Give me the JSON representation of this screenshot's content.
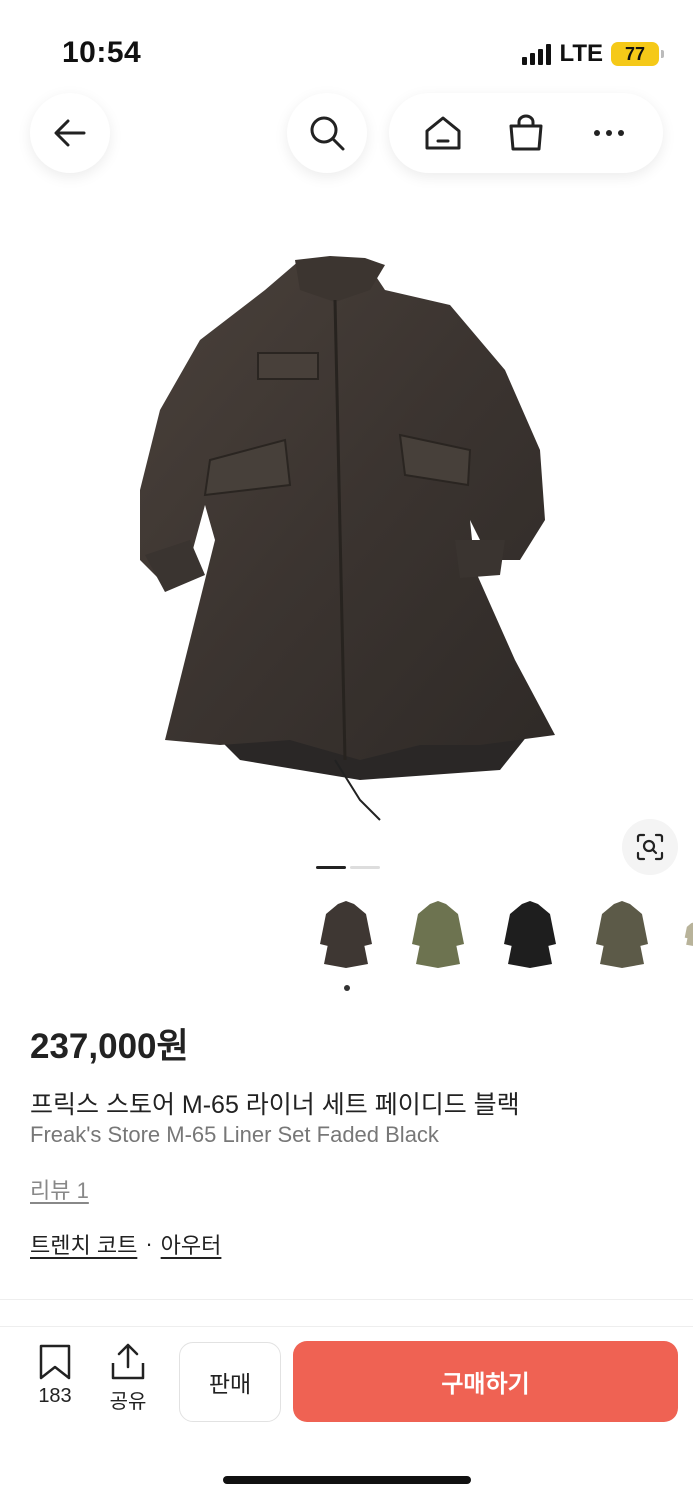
{
  "status": {
    "time": "10:54",
    "network": "LTE",
    "battery": "77"
  },
  "nav": {
    "back_icon": "arrow-left-icon",
    "search_icon": "search-icon",
    "home_icon": "home-icon",
    "cart_icon": "shopping-bag-icon",
    "more_icon": "more-horizontal-icon"
  },
  "gallery": {
    "page_index": 1,
    "page_count": 2,
    "thumbnails": [
      {
        "color": "#3e3733"
      },
      {
        "color": "#6d7350"
      },
      {
        "color": "#1e1e1e"
      },
      {
        "color": "#5c5a48"
      },
      {
        "color": "#b8b39a"
      }
    ],
    "selected_thumbnail": 0
  },
  "product": {
    "price": "237,000원",
    "title_ko": "프릭스 스토어 M-65 라이너 세트 페이디드 블랙",
    "title_en": "Freak's Store M-65 Liner Set Faded Black",
    "reviews": "리뷰 1",
    "category_1": "트렌치 코트",
    "separator": "·",
    "category_2": "아우터"
  },
  "bottom_bar": {
    "bookmark_count": "183",
    "share_label": "공유",
    "sell_label": "판매",
    "buy_label": "구매하기"
  },
  "colors": {
    "accent": "#ef6253",
    "battery": "#f5c918"
  }
}
